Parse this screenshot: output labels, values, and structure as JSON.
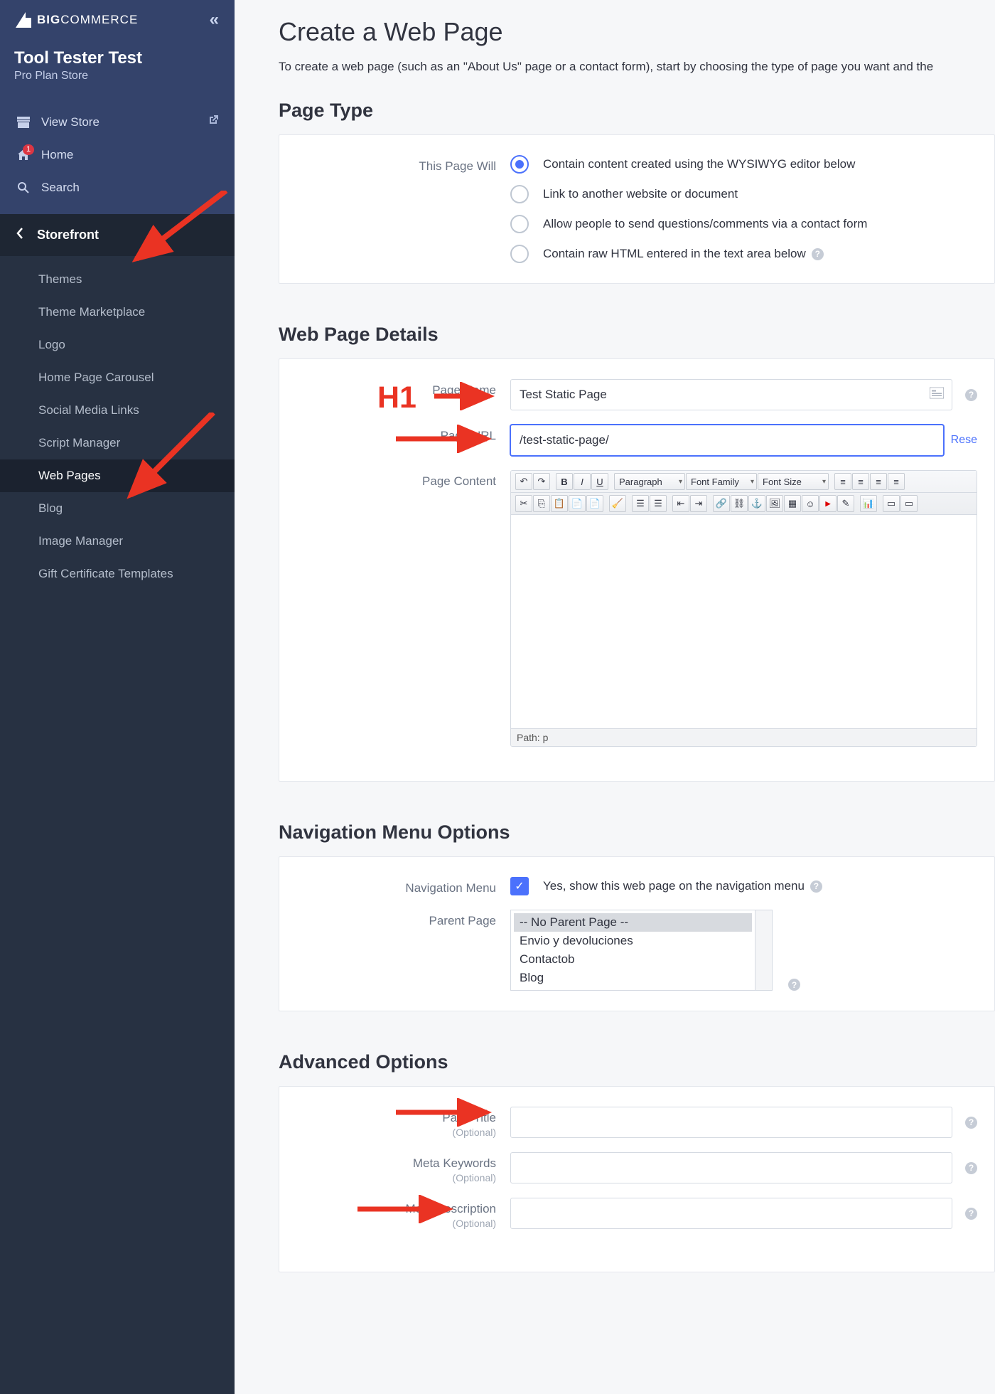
{
  "brand": "COMMERCE",
  "store": {
    "name": "Tool Tester Test",
    "plan": "Pro Plan Store"
  },
  "topNav": {
    "viewStore": "View Store",
    "home": "Home",
    "homeBadge": "1",
    "search": "Search"
  },
  "section": "Storefront",
  "subNav": [
    "Themes",
    "Theme Marketplace",
    "Logo",
    "Home Page Carousel",
    "Social Media Links",
    "Script Manager",
    "Web Pages",
    "Blog",
    "Image Manager",
    "Gift Certificate Templates"
  ],
  "activeIndex": 6,
  "page": {
    "title": "Create a Web Page",
    "intro": "To create a web page (such as an \"About Us\" page or a contact form), start by choosing the type of page you want and the"
  },
  "pageType": {
    "heading": "Page Type",
    "label": "This Page Will",
    "options": [
      "Contain content created using the WYSIWYG editor below",
      "Link to another website or document",
      "Allow people to send questions/comments via a contact form",
      "Contain raw HTML entered in the text area below"
    ],
    "selected": 0
  },
  "details": {
    "heading": "Web Page Details",
    "pageNameLabel": "Page Name",
    "pageNameValue": "Test Static Page",
    "pageUrlLabel": "Page URL",
    "pageUrlValue": "/test-static-page/",
    "resetLabel": "Rese",
    "contentLabel": "Page Content",
    "editorPath": "Path: p",
    "toolbar": {
      "paragraph": "Paragraph",
      "fontFamily": "Font Family",
      "fontSize": "Font Size"
    }
  },
  "navMenu": {
    "heading": "Navigation Menu Options",
    "label": "Navigation Menu",
    "checkLabel": "Yes, show this web page on the navigation menu",
    "parentLabel": "Parent Page",
    "options": [
      "-- No Parent Page --",
      "Envio y devoluciones",
      "Contactob",
      "Blog"
    ],
    "selected": 0
  },
  "advanced": {
    "heading": "Advanced Options",
    "pageTitle": "Page Title",
    "metaKeywords": "Meta Keywords",
    "metaDesc": "Meta Description",
    "optional": "(Optional)"
  },
  "annotations": {
    "h1": "H1"
  }
}
